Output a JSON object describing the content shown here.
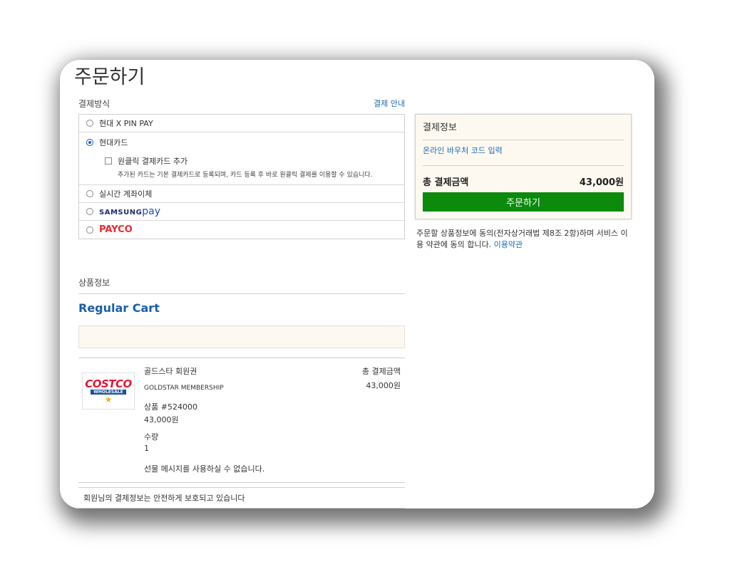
{
  "page": {
    "title": "주문하기"
  },
  "payment": {
    "section_title": "결제방식",
    "guide_link": "결제 안내",
    "options": [
      {
        "label": "현대 X PIN PAY",
        "selected": false
      },
      {
        "label": "현대카드",
        "selected": true
      },
      {
        "label": "실시간 계좌이체",
        "selected": false
      },
      {
        "label_brand": "SAMSUNG",
        "label_suffix": "pay",
        "selected": false
      },
      {
        "label": "PAYCO",
        "selected": false
      }
    ],
    "oneclick": {
      "label": "원클릭 결제카드 추가",
      "checked": false,
      "description": "추가된 카드는 기본 결제카드로 등록되며, 카드 등록 후 바로 원클릭 결제를 이용할 수 있습니다."
    }
  },
  "product": {
    "section_title": "상품정보",
    "cart_title": "Regular Cart",
    "logo": {
      "brand": "COSTCO",
      "sub": "WHOLESALE",
      "badge": "GOLDSTAR MEMBER"
    },
    "name": "골드스타 회원권",
    "sub_name": "GOLDSTAR MEMBERSHIP",
    "code": "상품 #524000",
    "price": "43,000원",
    "qty_label": "수량",
    "qty_value": "1",
    "gift_note": "선물 메시지를 사용하실 수 없습니다.",
    "total_label": "총 결제금액",
    "total_value": "43,000원",
    "secure_note": "회원님의 결제정보는 안전하게 보호되고 있습니다"
  },
  "summary": {
    "title": "결제정보",
    "voucher_link": "온라인 바우처 코드 입력",
    "total_label": "총 결제금액",
    "total_value": "43,000원",
    "order_button": "주문하기",
    "terms_text": "주문할 상품정보에 동의(전자상거래법 제8조 2항)하며 서비스 이용 약관에 동의 합니다.",
    "terms_link": "이용약관"
  },
  "colors": {
    "accent_blue": "#1a5fa8",
    "order_green": "#0b8a0b",
    "summary_bg": "#fdf9f0",
    "payco_red": "#f0262e"
  }
}
